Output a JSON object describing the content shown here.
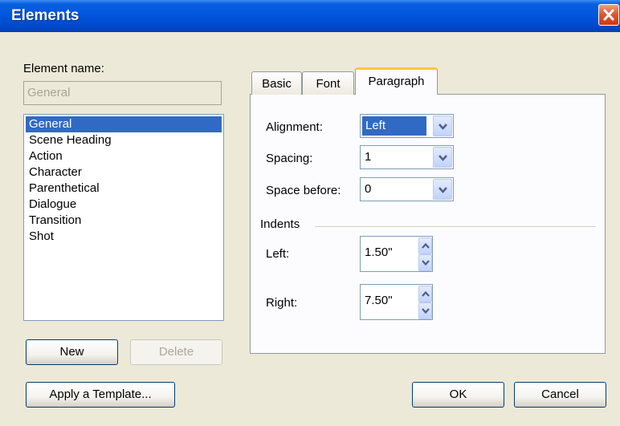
{
  "window": {
    "title": "Elements"
  },
  "left": {
    "element_name_label": "Element name:",
    "element_name_value": "General",
    "elements": [
      "General",
      "Scene Heading",
      "Action",
      "Character",
      "Parenthetical",
      "Dialogue",
      "Transition",
      "Shot"
    ],
    "selected_index": 0,
    "new_button": "New",
    "delete_button": "Delete",
    "apply_template_button": "Apply a Template..."
  },
  "tabs": [
    "Basic",
    "Font",
    "Paragraph"
  ],
  "active_tab": "Paragraph",
  "paragraph": {
    "alignment_label": "Alignment:",
    "alignment_value": "Left",
    "spacing_label": "Spacing:",
    "spacing_value": "1",
    "space_before_label": "Space before:",
    "space_before_value": "0",
    "indents_label": "Indents",
    "left_label": "Left:",
    "left_value": "1.50\"",
    "right_label": "Right:",
    "right_value": "7.50\""
  },
  "footer": {
    "ok_button": "OK",
    "cancel_button": "Cancel"
  },
  "colors": {
    "titlebar": "#0055dd",
    "selection": "#316ac5",
    "close": "#e2582c",
    "face": "#ece9d8",
    "active_tab_highlight": "#ffc73c"
  },
  "icons": {
    "close": "close-icon",
    "combo_arrow": "chevron-down-icon",
    "spin_up": "chevron-up-icon",
    "spin_down": "chevron-down-icon"
  }
}
